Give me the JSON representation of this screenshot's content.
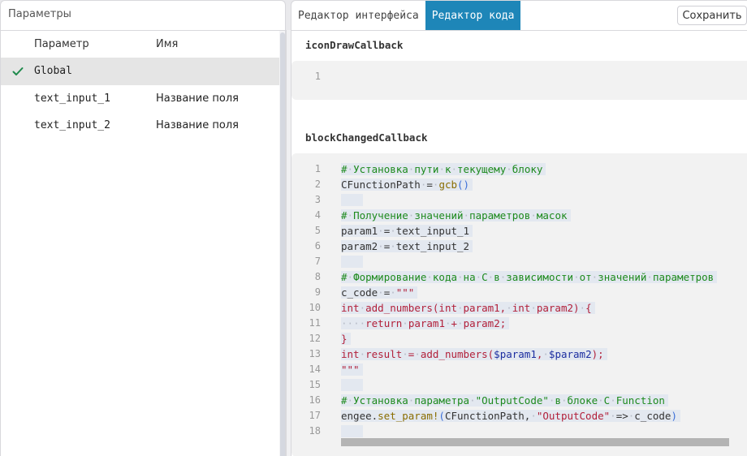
{
  "left": {
    "title": "Параметры",
    "columns": {
      "param": "Параметр",
      "name": "Имя"
    },
    "rows": [
      {
        "param": "Global",
        "name": "",
        "selected": true
      },
      {
        "param": "text_input_1",
        "name": "Название поля",
        "selected": false
      },
      {
        "param": "text_input_2",
        "name": "Название поля",
        "selected": false
      }
    ]
  },
  "right": {
    "tabs": [
      {
        "label": "Редактор интерфейса",
        "active": false
      },
      {
        "label": "Редактор кода",
        "active": true
      }
    ],
    "save_label": "Сохранить",
    "sections": [
      {
        "title": "iconDrawCallback",
        "lines": [
          {
            "num": "1",
            "text": ""
          }
        ]
      },
      {
        "title": "blockChangedCallback",
        "lines": [
          {
            "num": "1",
            "text": "# Установка пути к текущему блоку"
          },
          {
            "num": "2",
            "text": "CFunctionPath = gcb()"
          },
          {
            "num": "3",
            "text": ""
          },
          {
            "num": "4",
            "text": "# Получение значений параметров масок"
          },
          {
            "num": "5",
            "text": "param1 = text_input_1"
          },
          {
            "num": "6",
            "text": "param2 = text_input_2"
          },
          {
            "num": "7",
            "text": ""
          },
          {
            "num": "8",
            "text": "# Формирование кода на C в зависимости от значений параметров"
          },
          {
            "num": "9",
            "text": "c_code = \"\"\""
          },
          {
            "num": "10",
            "text": "int add_numbers(int param1, int param2) {"
          },
          {
            "num": "11",
            "text": "    return param1 + param2;"
          },
          {
            "num": "12",
            "text": "}"
          },
          {
            "num": "13",
            "text": "int result = add_numbers($param1, $param2);"
          },
          {
            "num": "14",
            "text": "\"\"\""
          },
          {
            "num": "15",
            "text": ""
          },
          {
            "num": "16",
            "text": "# Установка параметра \"OutputCode\" в блоке C Function"
          },
          {
            "num": "17",
            "text": "engee.set_param!(CFunctionPath, \"OutputCode\" => c_code)"
          },
          {
            "num": "18",
            "text": ""
          }
        ]
      }
    ]
  },
  "colors": {
    "accent_tab": "#1e86b8",
    "check": "#1f8a4c",
    "comment": "#1d8a1d",
    "string": "#b2203a",
    "function": "#8a6d00",
    "paren": "#3b6fd8",
    "variable": "#1c2ea0"
  }
}
